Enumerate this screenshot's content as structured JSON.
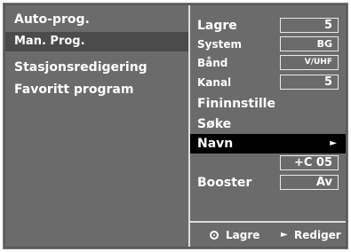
{
  "menu": {
    "items": [
      {
        "label": "Auto-prog."
      },
      {
        "label": "Man. Prog."
      },
      {
        "label": "Stasjonsredigering"
      },
      {
        "label": "Favoritt program"
      }
    ]
  },
  "settings": {
    "lagre": {
      "label": "Lagre",
      "value": "5"
    },
    "system": {
      "label": "System",
      "value": "BG"
    },
    "band": {
      "label": "Bånd",
      "value": "V/UHF"
    },
    "kanal": {
      "label": "Kanal",
      "value": "5"
    },
    "fininnstille": {
      "label": "Fininnstille"
    },
    "soke": {
      "label": "Søke"
    },
    "navn": {
      "label": "Navn",
      "arrow": "►",
      "value": "+C 05"
    },
    "booster": {
      "label": "Booster",
      "value": "Av"
    }
  },
  "footer": {
    "lagre_icon": "circle-button-icon",
    "lagre_label": "Lagre",
    "rediger_icon": "►",
    "rediger_label": "Rediger"
  },
  "colors": {
    "panel": "#6b6b6b",
    "selected_row": "#000000",
    "selected_menu": "#4b4b4b",
    "text": "#ffffff"
  }
}
